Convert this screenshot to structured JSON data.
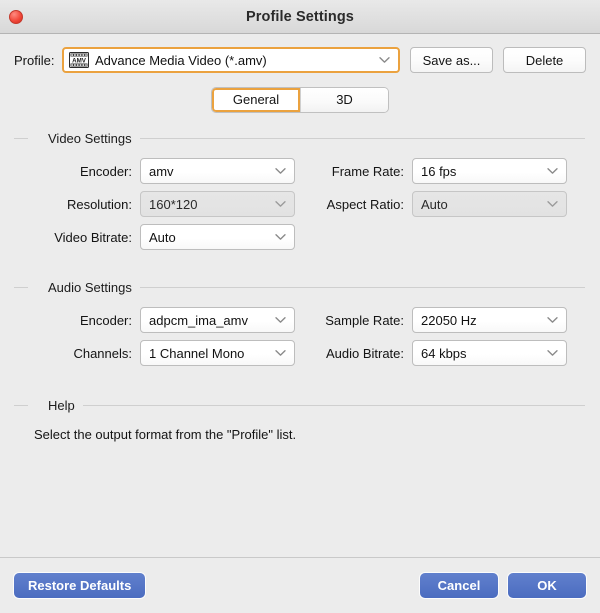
{
  "window": {
    "title": "Profile Settings",
    "close_icon": "close-button-red",
    "accent_orange": "#eba23f",
    "accent_blue": "#4f72c4",
    "background": "#ececec"
  },
  "profile_row": {
    "label": "Profile:",
    "icon": "amv-film-strip-icon",
    "icon_text": "AMV",
    "value": "Advance Media Video (*.amv)",
    "chevron_icon": "chevron-down-icon",
    "save_as_label": "Save as...",
    "delete_label": "Delete"
  },
  "tabs": [
    {
      "label": "General",
      "active": true
    },
    {
      "label": "3D",
      "active": false
    }
  ],
  "video_settings": {
    "title": "Video Settings",
    "fields": [
      {
        "label": "Encoder:",
        "value": "amv",
        "disabled": false
      },
      {
        "label": "Frame Rate:",
        "value": "16 fps",
        "disabled": false
      },
      {
        "label": "Resolution:",
        "value": "160*120",
        "disabled": true
      },
      {
        "label": "Aspect Ratio:",
        "value": "Auto",
        "disabled": true
      },
      {
        "label": "Video Bitrate:",
        "value": "Auto",
        "disabled": false
      }
    ]
  },
  "audio_settings": {
    "title": "Audio Settings",
    "fields": [
      {
        "label": "Encoder:",
        "value": "adpcm_ima_amv",
        "disabled": false
      },
      {
        "label": "Sample Rate:",
        "value": "22050 Hz",
        "disabled": false
      },
      {
        "label": "Channels:",
        "value": "1 Channel Mono",
        "disabled": false
      },
      {
        "label": "Audio Bitrate:",
        "value": "64 kbps",
        "disabled": false
      }
    ]
  },
  "help": {
    "title": "Help",
    "text": "Select the output format from the \"Profile\" list."
  },
  "footer": {
    "restore_label": "Restore Defaults",
    "cancel_label": "Cancel",
    "ok_label": "OK"
  }
}
